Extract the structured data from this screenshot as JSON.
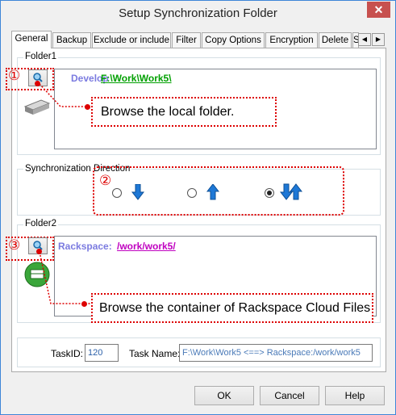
{
  "window": {
    "title": "Setup Synchronization Folder",
    "close_glyph": "✕"
  },
  "tabs": [
    {
      "label": "General"
    },
    {
      "label": "Backup"
    },
    {
      "label": "Exclude or include"
    },
    {
      "label": "Filter"
    },
    {
      "label": "Copy Options"
    },
    {
      "label": "Encryption"
    },
    {
      "label": "Delete"
    },
    {
      "label": "S"
    }
  ],
  "tab_scroll": {
    "left": "◀",
    "right": "▶"
  },
  "folder1": {
    "label": "Folder1",
    "tag": "Develop",
    "path": "F:\\Work\\Work5\\",
    "marker": "①",
    "callout": "Browse the local folder."
  },
  "direction": {
    "label": "Synchronization Direction",
    "marker": "②",
    "options": [
      {
        "name": "download",
        "selected": false
      },
      {
        "name": "upload",
        "selected": false
      },
      {
        "name": "both",
        "selected": true
      }
    ]
  },
  "folder2": {
    "label": "Folder2",
    "tag": "Rackspace:",
    "path": "/work/work5/",
    "marker": "③",
    "callout": "Browse the container of Rackspace Cloud Files"
  },
  "task": {
    "id_label": "TaskID:",
    "id_value": "120",
    "name_label": "Task Name:",
    "name_value": "F:\\Work\\Work5 <==> Rackspace:/work/work5"
  },
  "buttons": {
    "ok": "OK",
    "cancel": "Cancel",
    "help": "Help"
  },
  "colors": {
    "accent_red": "#dd0000",
    "path_green": "#00a000",
    "path_magenta": "#c000c0",
    "tag_purple": "#7b7be0",
    "arrow_blue": "#1e78d6",
    "close_red": "#c7504e"
  }
}
